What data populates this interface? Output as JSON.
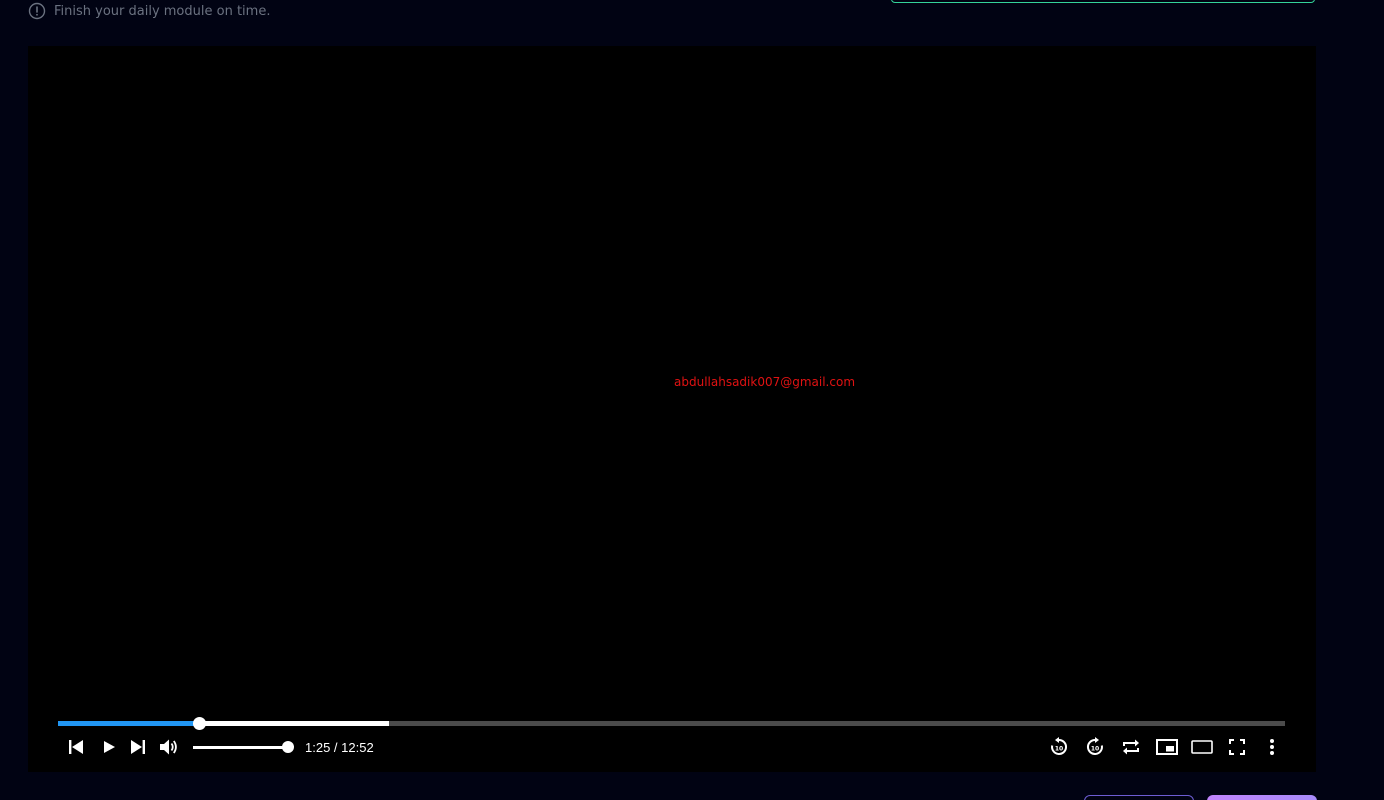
{
  "notice": {
    "icon": "info-circle-icon",
    "text": "Finish your daily module on time."
  },
  "player": {
    "watermark": "abdullahsadik007@gmail.com",
    "current_time": "1:25",
    "duration": "12:52",
    "time_display": "1:25 / 12:52",
    "progress_fraction": 0.115,
    "buffered_fraction": 0.27,
    "volume_fraction": 1.0,
    "colors": {
      "played": "#2196f3",
      "buffered": "#ffffff",
      "track": "#4b4b4b",
      "watermark": "#e01212"
    },
    "controls_left": [
      "skip-previous-icon",
      "play-icon",
      "skip-next-icon",
      "volume-icon"
    ],
    "controls_right": [
      "rewind-10-icon",
      "forward-10-icon",
      "loop-icon",
      "picture-in-picture-icon",
      "theater-mode-icon",
      "fullscreen-icon",
      "more-options-icon"
    ]
  }
}
